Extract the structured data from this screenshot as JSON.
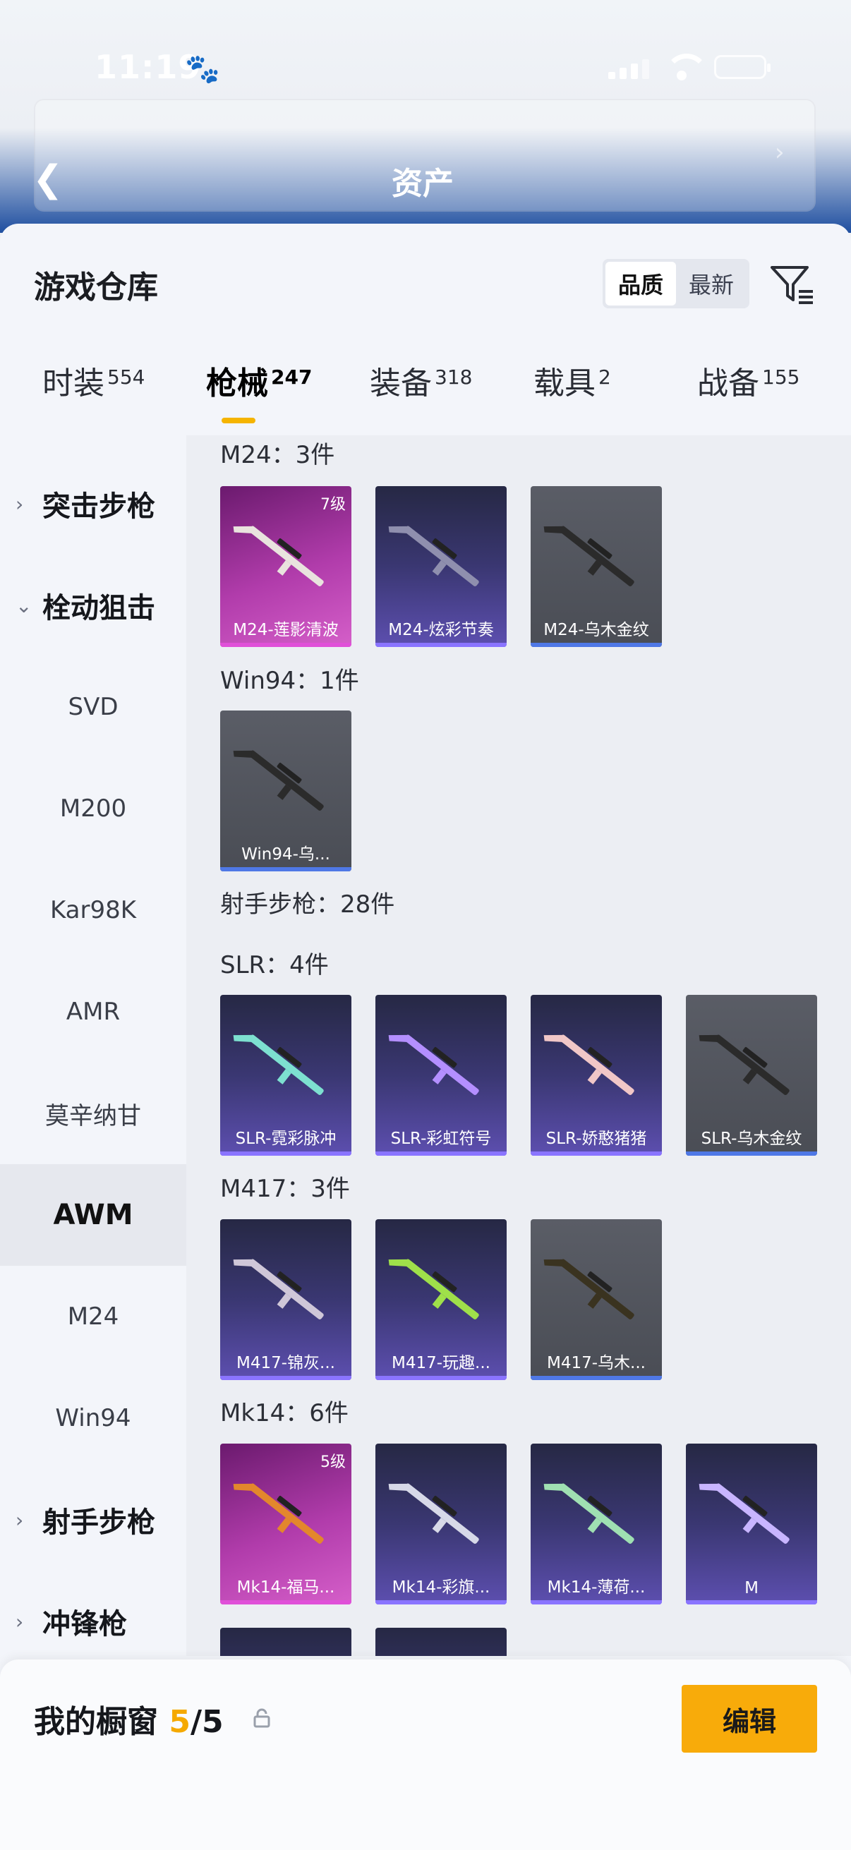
{
  "status": {
    "time": "11:19",
    "paw": "🐾"
  },
  "header": {
    "title": "资产"
  },
  "warehouse": {
    "title": "游戏仓库",
    "sort_quality": "品质",
    "sort_latest": "最新"
  },
  "tabs": [
    {
      "label": "时装",
      "count": "554"
    },
    {
      "label": "枪械",
      "count": "247"
    },
    {
      "label": "装备",
      "count": "318"
    },
    {
      "label": "载具",
      "count": "2"
    },
    {
      "label": "战备",
      "count": "155"
    }
  ],
  "sidebar": [
    {
      "label": "突击步枪"
    },
    {
      "label": "栓动狙击"
    },
    {
      "label": "SVD"
    },
    {
      "label": "M200"
    },
    {
      "label": "Kar98K"
    },
    {
      "label": "AMR"
    },
    {
      "label": "莫辛纳甘"
    },
    {
      "label": "AWM"
    },
    {
      "label": "M24"
    },
    {
      "label": "Win94"
    },
    {
      "label": "射手步枪"
    },
    {
      "label": "冲锋枪"
    }
  ],
  "sections": [
    {
      "title": "M24：3件"
    },
    {
      "title": "Win94：1件"
    },
    {
      "title": "射手步枪：28件"
    },
    {
      "title": "SLR：4件"
    },
    {
      "title": "M417：3件"
    },
    {
      "title": "Mk14：6件"
    }
  ],
  "cards": [
    {
      "label": "M24-莲影清波",
      "level": "7级",
      "rarity": "pink"
    },
    {
      "label": "M24-炫彩节奏",
      "rarity": "purple"
    },
    {
      "label": "M24-乌木金纹",
      "rarity": "gray"
    },
    {
      "label": "Win94-乌...",
      "rarity": "gray"
    },
    {
      "label": "SLR-霓彩脉冲",
      "rarity": "purple"
    },
    {
      "label": "SLR-彩虹符号",
      "rarity": "purple"
    },
    {
      "label": "SLR-娇憨猪猪",
      "rarity": "purple"
    },
    {
      "label": "SLR-乌木金纹",
      "rarity": "gray"
    },
    {
      "label": "M417-锦灰...",
      "rarity": "purple"
    },
    {
      "label": "M417-玩趣...",
      "rarity": "purple"
    },
    {
      "label": "M417-乌木...",
      "rarity": "gray"
    },
    {
      "label": "Mk14-福马...",
      "level": "5级",
      "rarity": "pink"
    },
    {
      "label": "Mk14-彩旗...",
      "rarity": "purple"
    },
    {
      "label": "Mk14-薄荷...",
      "rarity": "purple"
    },
    {
      "label": "M",
      "rarity": "purple"
    }
  ],
  "showcase": {
    "title": "我的橱窗",
    "count": "5",
    "total": "/5",
    "edit_label": "编辑"
  },
  "colors": {
    "accent": "#f5b400",
    "pink_rarity": "#e050d8",
    "purple_rarity": "#8a74ff",
    "blue_rarity": "#4f78e6"
  }
}
